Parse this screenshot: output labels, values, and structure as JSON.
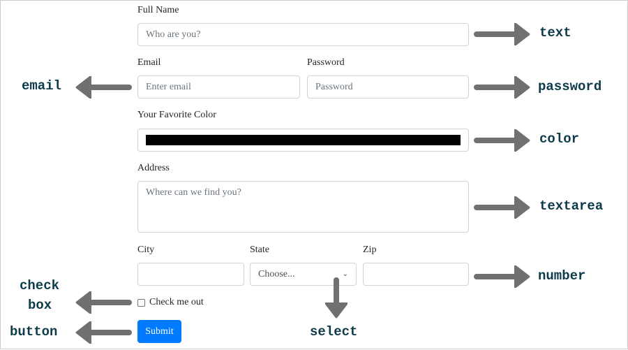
{
  "form": {
    "full_name": {
      "label": "Full Name",
      "placeholder": "Who are you?"
    },
    "email": {
      "label": "Email",
      "placeholder": "Enter email"
    },
    "password": {
      "label": "Password",
      "placeholder": "Password"
    },
    "color": {
      "label": "Your Favorite Color",
      "value": "#000000"
    },
    "address": {
      "label": "Address",
      "placeholder": "Where can we find you?"
    },
    "city": {
      "label": "City"
    },
    "state": {
      "label": "State",
      "selected": "Choose..."
    },
    "zip": {
      "label": "Zip"
    },
    "checkbox": {
      "label": "Check me out",
      "checked": false
    },
    "submit": {
      "label": "Submit",
      "color": "#007bff"
    }
  },
  "annotations": {
    "text": "text",
    "password": "password",
    "color": "color",
    "textarea": "textarea",
    "number": "number",
    "email": "email",
    "check": "check",
    "box": "box",
    "button": "button",
    "select": "select"
  },
  "arrow_color": "#707070"
}
